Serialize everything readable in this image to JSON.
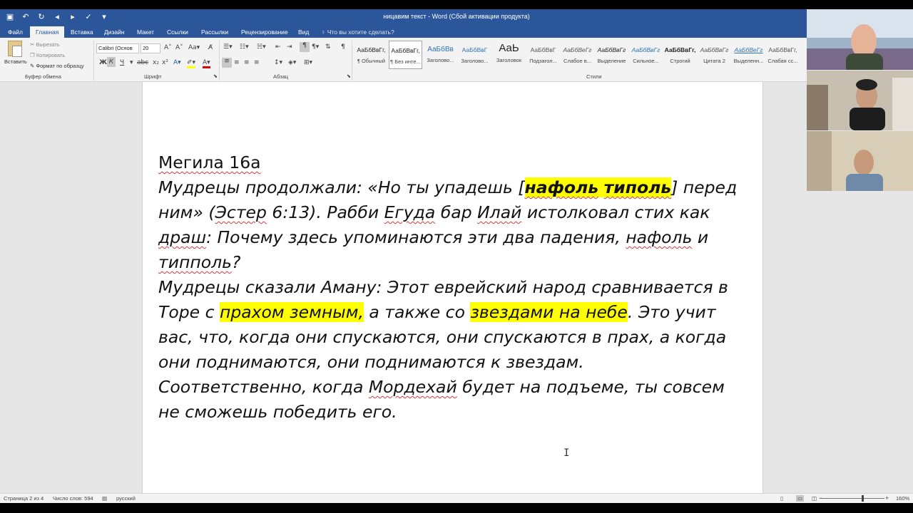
{
  "window": {
    "title": "ницавим текст - Word (Сбой активации продукта)"
  },
  "tabs": [
    {
      "label": "Файл",
      "active": false
    },
    {
      "label": "Главная",
      "active": true
    },
    {
      "label": "Вставка",
      "active": false
    },
    {
      "label": "Дизайн",
      "active": false
    },
    {
      "label": "Макет",
      "active": false
    },
    {
      "label": "Ссылки",
      "active": false
    },
    {
      "label": "Рассылки",
      "active": false
    },
    {
      "label": "Рецензирование",
      "active": false
    },
    {
      "label": "Вид",
      "active": false
    }
  ],
  "tell_me": "Что вы хотите сделать?",
  "clipboard": {
    "paste_label": "Вставить",
    "cut_label": "Вырезать",
    "copy_label": "Копировать",
    "format_painter_label": "Формат по образцу",
    "group_label": "Буфер обмена"
  },
  "font": {
    "family_value": "Calibri (Основ",
    "size_value": "20",
    "group_label": "Шрифт"
  },
  "paragraph": {
    "group_label": "Абзац"
  },
  "styles": {
    "group_label": "Стили",
    "items": [
      {
        "preview": "АаБбВвГг,",
        "name": "¶ Обычный"
      },
      {
        "preview": "АаБбВвГг,",
        "name": "¶ Без инте..."
      },
      {
        "preview": "АаБбВв",
        "name": "Заголово..."
      },
      {
        "preview": "АаБбВвГ",
        "name": "Заголово..."
      },
      {
        "preview": "АаЬ",
        "name": "Заголовок"
      },
      {
        "preview": "АаБбВвГ",
        "name": "Подзагол..."
      },
      {
        "preview": "АаБбВеГг",
        "name": "Слабое в..."
      },
      {
        "preview": "АаБбВвГг",
        "name": "Выделение"
      },
      {
        "preview": "АаБбВвГг",
        "name": "Сильное..."
      },
      {
        "preview": "АаБбВвГг,",
        "name": "Строгий"
      },
      {
        "preview": "АаБбВвГг",
        "name": "Цитата 2"
      },
      {
        "preview": "АаБбВеГг",
        "name": "Выделенн..."
      },
      {
        "preview": "АаБбВвГг,",
        "name": "Слабая сс..."
      }
    ]
  },
  "document": {
    "heading": "Мегила 16а",
    "p1": {
      "a": "Мудрецы продолжали: «Но ты упадешь [",
      "hl1": "нафоль",
      "sp": " ",
      "hl2": "типоль",
      "b": "] перед ним» (",
      "w_ester": "Эстер",
      "c": " 6:13). Рабби ",
      "w_egud": "Егуда",
      "d": " бар ",
      "w_ilai": "Илай",
      "e": " истолковал стих как ",
      "w_drash": "драш",
      "f": ": Почему здесь упоминаются эти два падения, ",
      "w_nafol": "нафоль",
      "g": " и ",
      "w_tippol": "типполь",
      "h": "?"
    },
    "p2": {
      "a": "Мудрецы сказали Аману: Этот еврейский народ сравнивается в Торе с ",
      "hl1": "прахом земным,",
      "b": " а также со ",
      "hl2": "звездами на небе",
      "c": ". Это учит вас, что, когда они спускаются, они спускаются в прах, а когда они поднимаются, они поднимаются к звездам."
    },
    "p3": {
      "a": "Соответственно, когда ",
      "w_mordechai": "Мордехай",
      "b": " будет на подъеме, ты совсем не сможешь победить его."
    }
  },
  "status": {
    "page": "Страница 2 из 4",
    "words": "Число слов: 594",
    "language": "русский",
    "zoom": "160%"
  }
}
